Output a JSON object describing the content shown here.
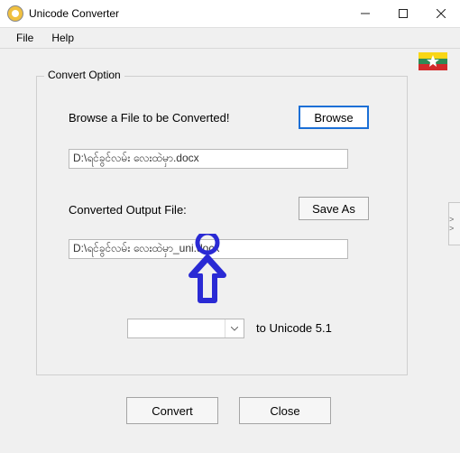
{
  "title": "Unicode Converter",
  "menu": {
    "file": "File",
    "help": "Help"
  },
  "group": {
    "legend": "Convert Option",
    "browse_label": "Browse a File to be Converted!",
    "browse_button": "Browse",
    "input_path": "D:\\ရင်ခွင်လမ်း လေးထဲမှာ.docx",
    "output_label": "Converted Output File:",
    "saveas_button": "Save As",
    "output_path": "D:\\ရင်ခွင်လမ်း လေးထဲမှာ_uni.docx",
    "select_value": "",
    "to_label": "to Unicode 5.1"
  },
  "buttons": {
    "convert": "Convert",
    "close": "Close"
  },
  "side_handle": "> >"
}
